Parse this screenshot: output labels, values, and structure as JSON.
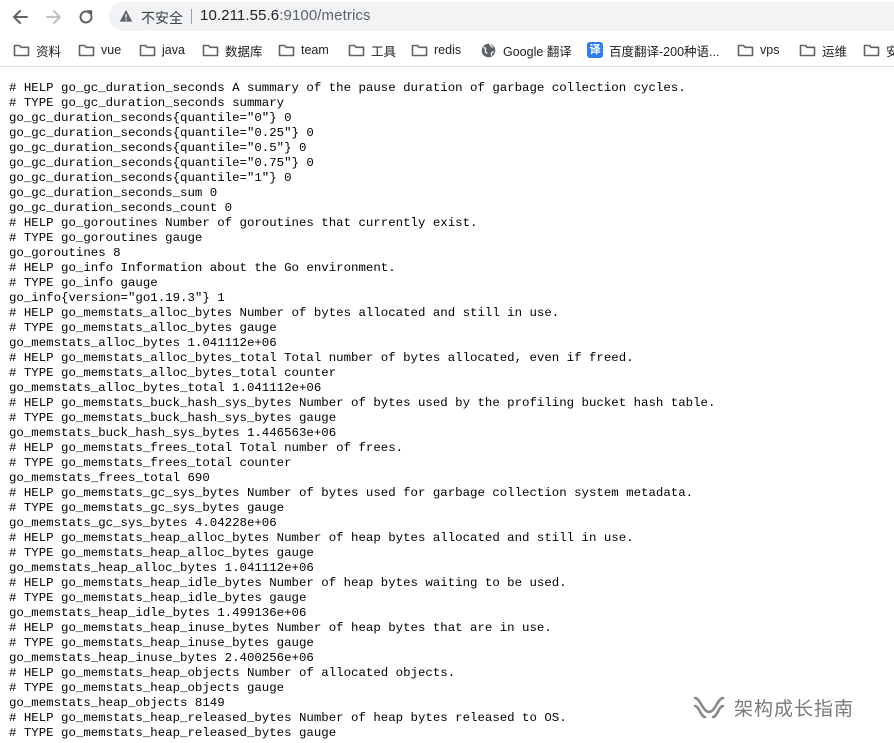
{
  "toolbar": {
    "back_icon": "arrow-left-icon",
    "forward_icon": "arrow-right-icon",
    "reload_icon": "reload-icon",
    "security_icon": "warning-triangle-icon",
    "security_label": "不安全",
    "url_host": "10.211.55.6",
    "url_path": ":9100/metrics"
  },
  "bookmarks": [
    {
      "label": "资料",
      "icon": "folder-icon"
    },
    {
      "label": "vue",
      "icon": "folder-icon"
    },
    {
      "label": "java",
      "icon": "folder-icon"
    },
    {
      "label": "数据库",
      "icon": "folder-icon"
    },
    {
      "label": "team",
      "icon": "folder-icon"
    },
    {
      "label": "工具",
      "icon": "folder-icon"
    },
    {
      "label": "redis",
      "icon": "folder-icon"
    },
    {
      "label": "Google 翻译",
      "icon": "globe-icon"
    },
    {
      "label": "百度翻译-200种语...",
      "icon": "translate-icon",
      "icon_text": "译"
    },
    {
      "label": "vps",
      "icon": "folder-icon"
    },
    {
      "label": "运维",
      "icon": "folder-icon"
    },
    {
      "label": "安",
      "icon": "folder-icon"
    }
  ],
  "metrics_lines": [
    "# HELP go_gc_duration_seconds A summary of the pause duration of garbage collection cycles.",
    "# TYPE go_gc_duration_seconds summary",
    "go_gc_duration_seconds{quantile=\"0\"} 0",
    "go_gc_duration_seconds{quantile=\"0.25\"} 0",
    "go_gc_duration_seconds{quantile=\"0.5\"} 0",
    "go_gc_duration_seconds{quantile=\"0.75\"} 0",
    "go_gc_duration_seconds{quantile=\"1\"} 0",
    "go_gc_duration_seconds_sum 0",
    "go_gc_duration_seconds_count 0",
    "# HELP go_goroutines Number of goroutines that currently exist.",
    "# TYPE go_goroutines gauge",
    "go_goroutines 8",
    "# HELP go_info Information about the Go environment.",
    "# TYPE go_info gauge",
    "go_info{version=\"go1.19.3\"} 1",
    "# HELP go_memstats_alloc_bytes Number of bytes allocated and still in use.",
    "# TYPE go_memstats_alloc_bytes gauge",
    "go_memstats_alloc_bytes 1.041112e+06",
    "# HELP go_memstats_alloc_bytes_total Total number of bytes allocated, even if freed.",
    "# TYPE go_memstats_alloc_bytes_total counter",
    "go_memstats_alloc_bytes_total 1.041112e+06",
    "# HELP go_memstats_buck_hash_sys_bytes Number of bytes used by the profiling bucket hash table.",
    "# TYPE go_memstats_buck_hash_sys_bytes gauge",
    "go_memstats_buck_hash_sys_bytes 1.446563e+06",
    "# HELP go_memstats_frees_total Total number of frees.",
    "# TYPE go_memstats_frees_total counter",
    "go_memstats_frees_total 690",
    "# HELP go_memstats_gc_sys_bytes Number of bytes used for garbage collection system metadata.",
    "# TYPE go_memstats_gc_sys_bytes gauge",
    "go_memstats_gc_sys_bytes 4.04228e+06",
    "# HELP go_memstats_heap_alloc_bytes Number of heap bytes allocated and still in use.",
    "# TYPE go_memstats_heap_alloc_bytes gauge",
    "go_memstats_heap_alloc_bytes 1.041112e+06",
    "# HELP go_memstats_heap_idle_bytes Number of heap bytes waiting to be used.",
    "# TYPE go_memstats_heap_idle_bytes gauge",
    "go_memstats_heap_idle_bytes 1.499136e+06",
    "# HELP go_memstats_heap_inuse_bytes Number of heap bytes that are in use.",
    "# TYPE go_memstats_heap_inuse_bytes gauge",
    "go_memstats_heap_inuse_bytes 2.400256e+06",
    "# HELP go_memstats_heap_objects Number of allocated objects.",
    "# TYPE go_memstats_heap_objects gauge",
    "go_memstats_heap_objects 8149",
    "# HELP go_memstats_heap_released_bytes Number of heap bytes released to OS.",
    "# TYPE go_memstats_heap_released_bytes gauge"
  ],
  "watermark": {
    "icon": "wechat-channel-icon",
    "text": "架构成长指南"
  }
}
